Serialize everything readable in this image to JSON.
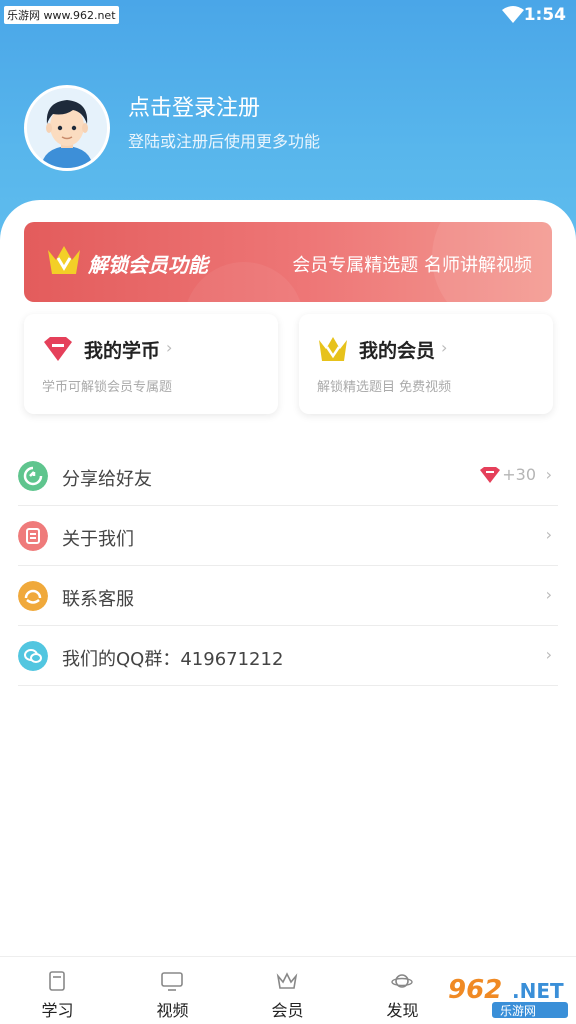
{
  "status_bar": {
    "watermark": "乐游网 www.962.net",
    "time": "1:54"
  },
  "profile": {
    "login_title": "点击登录注册",
    "login_subtitle": "登陆或注册后使用更多功能"
  },
  "vip_banner": {
    "title": "解锁会员功能",
    "subtitle": "会员专属精选题 名师讲解视频"
  },
  "cards": [
    {
      "title": "我的学币",
      "subtitle": "学币可解锁会员专属题",
      "icon": "gem-icon"
    },
    {
      "title": "我的会员",
      "subtitle": "解锁精选题目 免费视频",
      "icon": "crown-icon"
    }
  ],
  "list": [
    {
      "label": "分享给好友",
      "bonus": "+30",
      "icon": "share-icon",
      "color": "#5fc58e"
    },
    {
      "label": "关于我们",
      "icon": "about-icon",
      "color": "#ef7b7b"
    },
    {
      "label": "联系客服",
      "icon": "support-icon",
      "color": "#f0a93b"
    },
    {
      "label": "我们的QQ群：419671212",
      "icon": "qq-group-icon",
      "color": "#52c6e0"
    }
  ],
  "chevron": "›",
  "bottom_nav": [
    {
      "label": "学习",
      "icon": "book-icon"
    },
    {
      "label": "视频",
      "icon": "tv-icon"
    },
    {
      "label": "会员",
      "icon": "crown-icon"
    },
    {
      "label": "发现",
      "icon": "planet-icon"
    }
  ],
  "bottom_watermark": "962 NET 乐游网",
  "colors": {
    "header_blue": "#4aa6e8",
    "banner_red": "#e35c5c",
    "gem_red": "#e5405a",
    "crown_gold": "#e7c21b"
  }
}
